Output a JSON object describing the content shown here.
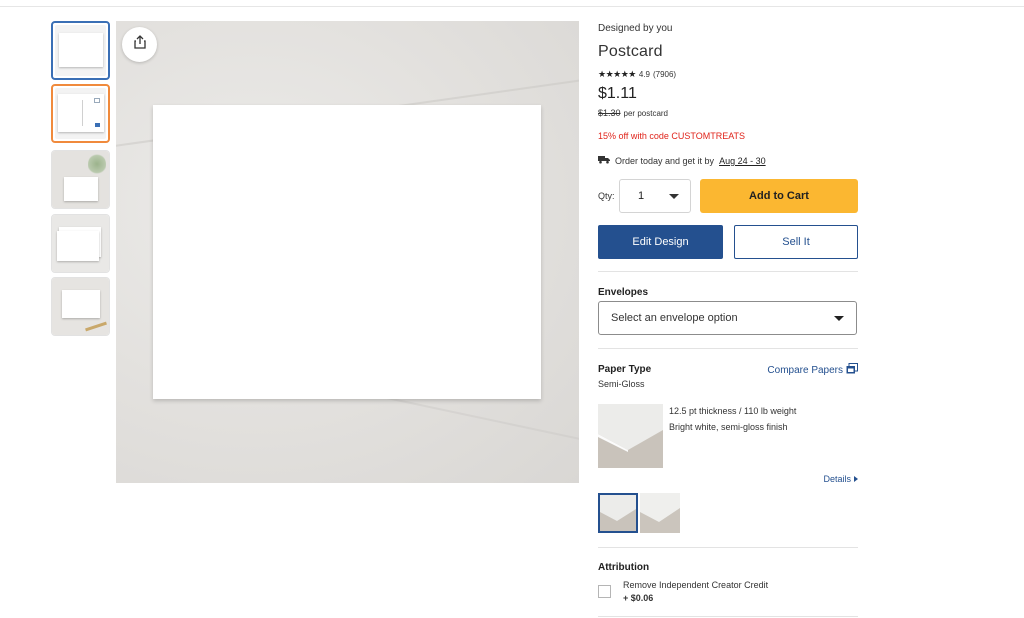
{
  "product": {
    "designed_by": "Designed by you",
    "title": "Postcard",
    "stars": "★★★★★",
    "rating": "4.9",
    "review_count": "(7906)",
    "price": "$1.11",
    "original_price": "$1.30",
    "price_unit": "per postcard",
    "promo": "15% off with code CUSTOMTREATS",
    "delivery_prefix": "Order today and get it by",
    "delivery_date": "Aug 24 - 30"
  },
  "purchase": {
    "qty_label": "Qty:",
    "qty_value": "1",
    "add_to_cart": "Add to Cart",
    "edit_design": "Edit Design",
    "sell_it": "Sell It"
  },
  "envelopes": {
    "title": "Envelopes",
    "placeholder": "Select an envelope option"
  },
  "paper": {
    "title": "Paper Type",
    "selected": "Semi-Gloss",
    "compare_link": "Compare Papers",
    "desc_line1": "12.5 pt thickness / 110 lb weight",
    "desc_line2": "Bright white, semi-gloss finish",
    "details_link": "Details"
  },
  "attribution": {
    "title": "Attribution",
    "option_label": "Remove Independent Creator Credit",
    "option_price": "+ $0.06"
  },
  "colors": {
    "brand_blue": "#24508f",
    "cart_yellow": "#fbb731",
    "promo_red": "#e0241b",
    "thumb_selected": "#3a6fb5",
    "thumb_hover": "#f08a3c"
  },
  "icons": [
    "share-icon",
    "truck-icon",
    "chevron-down-icon",
    "compare-icon",
    "caret-right-icon"
  ]
}
